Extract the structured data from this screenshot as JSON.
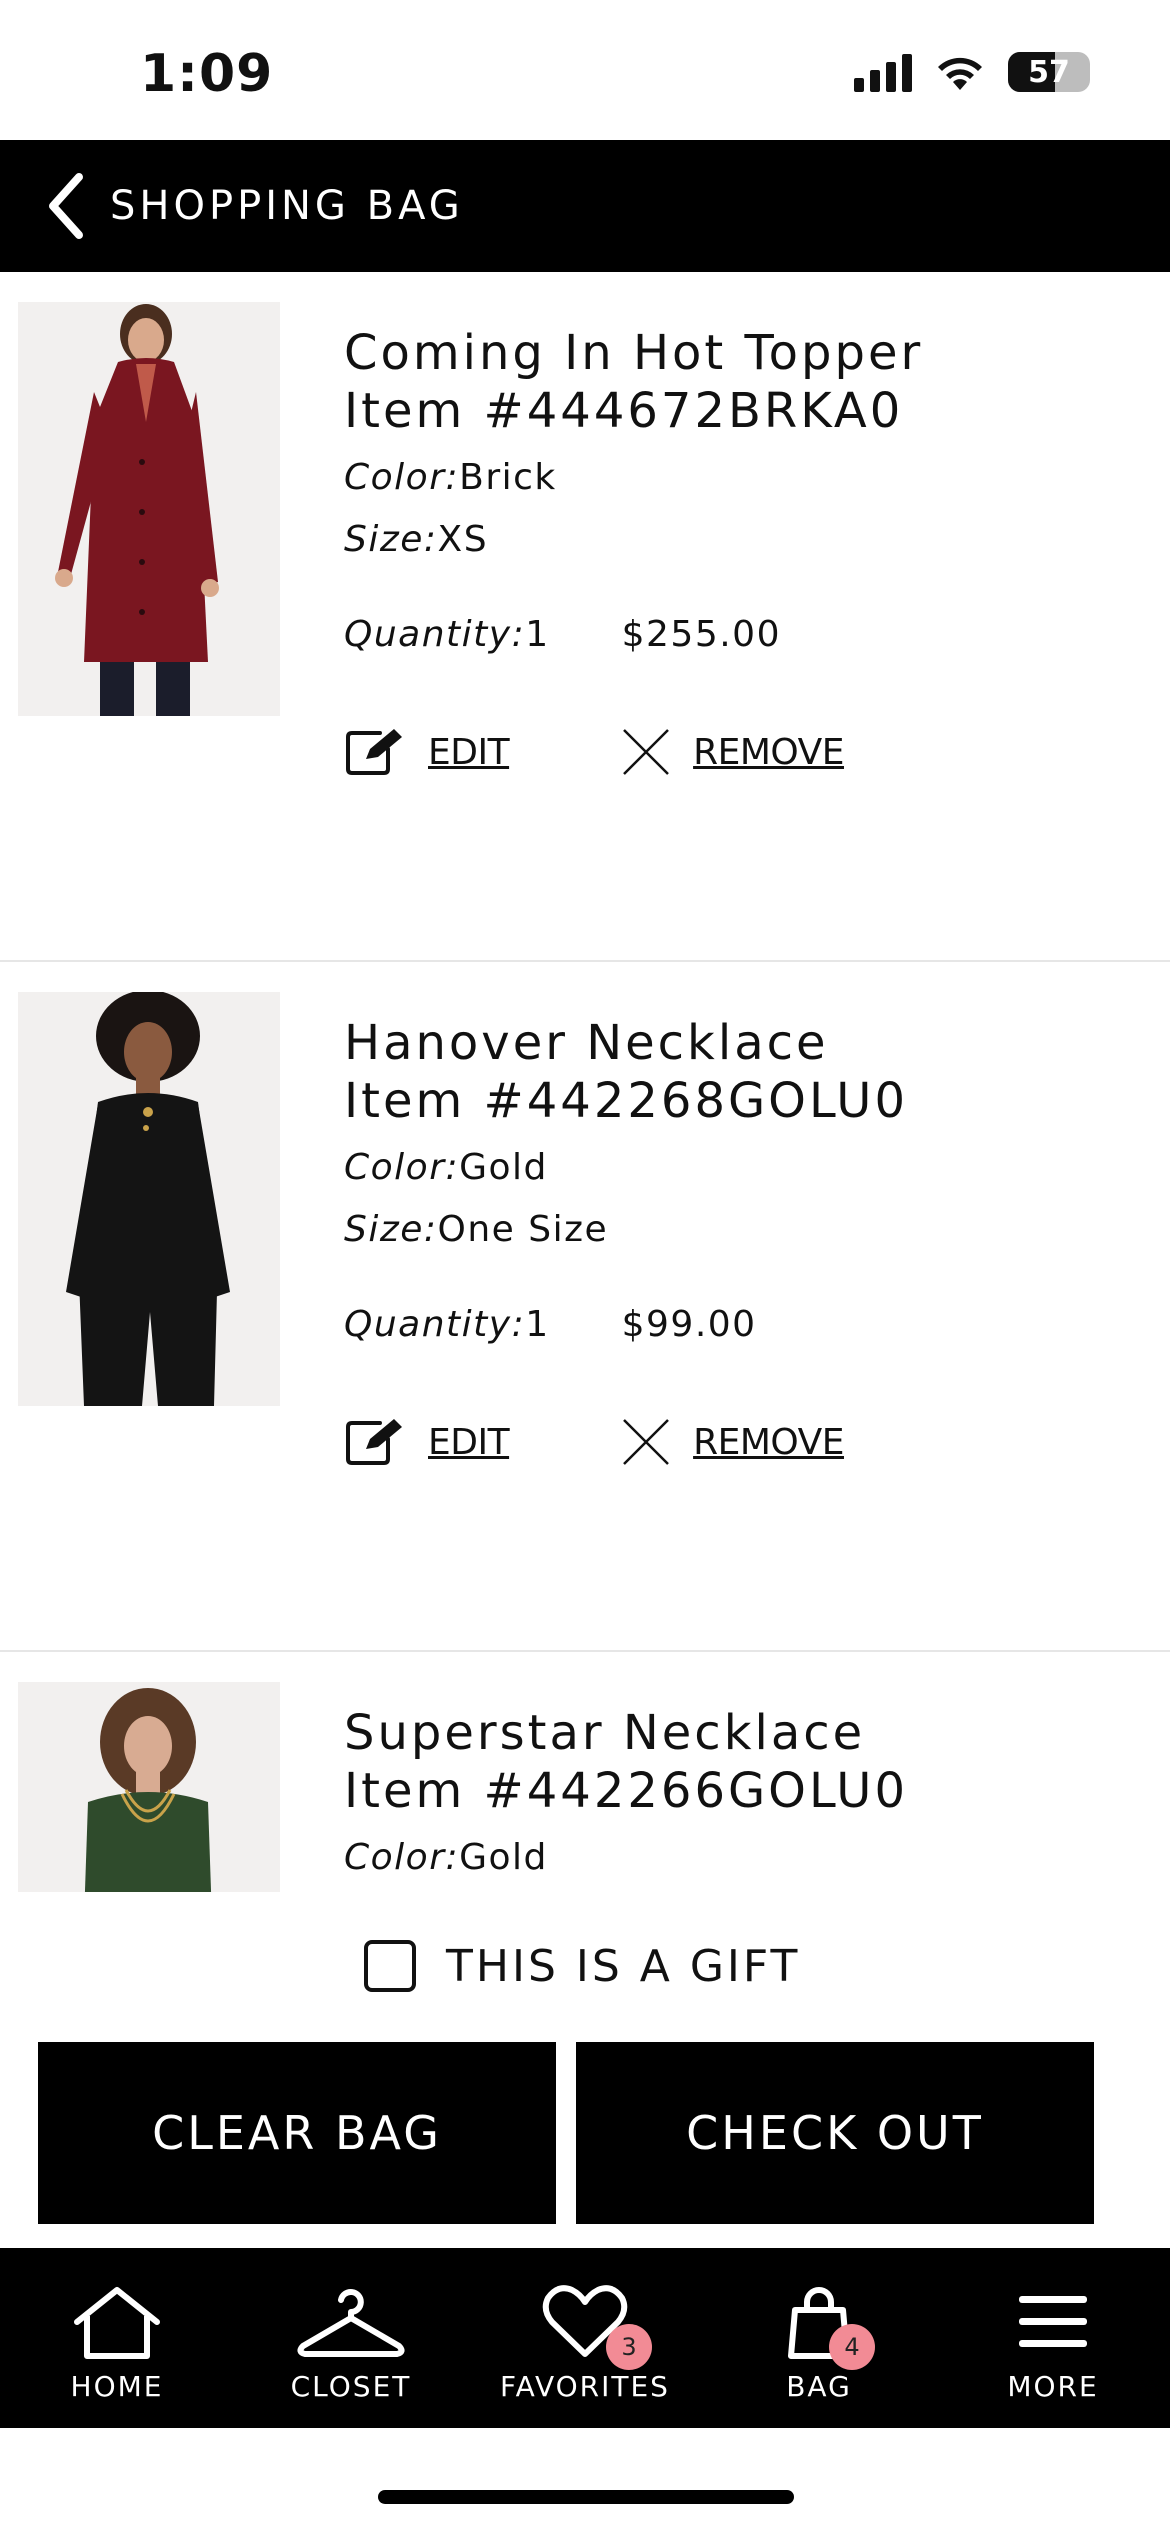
{
  "status_bar": {
    "time": "1:09",
    "battery_percent": 57,
    "battery_label": "57"
  },
  "header": {
    "title": "SHOPPING BAG"
  },
  "items": [
    {
      "title": "Coming In Hot Topper",
      "item_number": "Item #444672BRKA0",
      "color_label": "Color:",
      "color_value": "Brick",
      "size_label": "Size:",
      "size_value": "XS",
      "quantity_label": "Quantity:",
      "quantity_value": "1",
      "price": "$255.00",
      "edit_label": "EDIT",
      "remove_label": "REMOVE",
      "image_colors": {
        "garment": "#7a1620",
        "skin": "#d9a98c",
        "hair": "#4a2e1f",
        "pants": "#1b1d2b"
      }
    },
    {
      "title": "Hanover Necklace",
      "item_number": "Item #442268GOLU0",
      "color_label": "Color:",
      "color_value": "Gold",
      "size_label": "Size:",
      "size_value": "One Size",
      "quantity_label": "Quantity:",
      "quantity_value": "1",
      "price": "$99.00",
      "edit_label": "EDIT",
      "remove_label": "REMOVE",
      "image_colors": {
        "garment": "#141414",
        "skin": "#8a5a3f",
        "hair": "#1a1412",
        "pants": "#141414"
      }
    },
    {
      "title": "Superstar Necklace",
      "item_number": "Item #442266GOLU0",
      "color_label": "Color:",
      "color_value": "Gold",
      "image_colors": {
        "garment": "#2f4b2c",
        "skin": "#d8ab92",
        "hair": "#5a3a26"
      }
    }
  ],
  "gift": {
    "label": "THIS IS A GIFT",
    "checked": false
  },
  "buttons": {
    "clear_bag": "CLEAR BAG",
    "check_out": "CHECK OUT"
  },
  "tab_bar": {
    "home": "HOME",
    "closet": "CLOSET",
    "favorites": "FAVORITES",
    "favorites_badge": "3",
    "bag": "BAG",
    "bag_badge": "4",
    "more": "MORE"
  },
  "colors": {
    "black": "#000000",
    "badge": "#f28b95",
    "divider": "#e6e6e6"
  }
}
